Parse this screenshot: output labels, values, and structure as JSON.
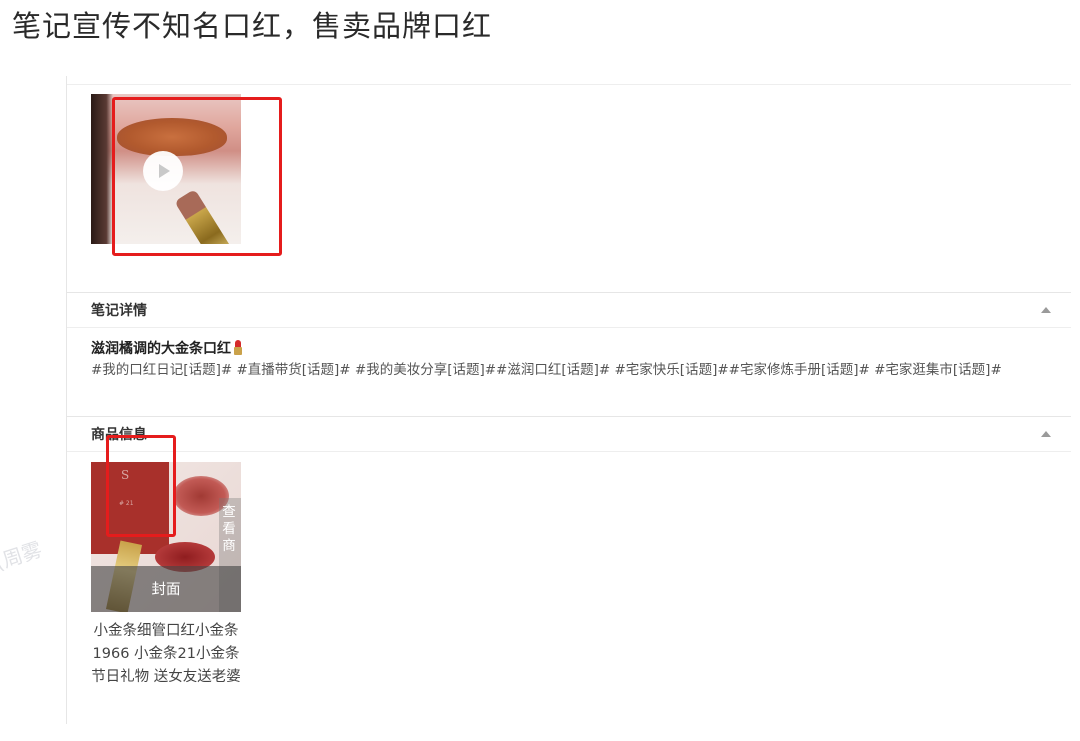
{
  "headline": "笔记宣传不知名口红，售卖品牌口红",
  "watermark": "(周雾",
  "video": {
    "play_icon": "play-icon"
  },
  "sections": {
    "note_details": {
      "header": "笔记详情",
      "title": "滋润橘调的大金条口红",
      "title_emoji": "lipstick-icon",
      "tags": "#我的口红日记[话题]# #直播带货[话题]# #我的美妆分享[话题]##滋润口红[话题]# #宅家快乐[话题]##宅家修炼手册[话题]# #宅家逛集市[话题]#"
    },
    "product_info": {
      "header": "商品信息",
      "cover_label": "封面",
      "side_label": "查看商",
      "product_name": "小金条细管口红小金条1966 小金条21小金条节日礼物 送女友送老婆",
      "brand_mark": "S",
      "box_code": "# 21"
    }
  },
  "colors": {
    "highlight_box": "#e51c1c",
    "border": "#e6e6e6"
  }
}
